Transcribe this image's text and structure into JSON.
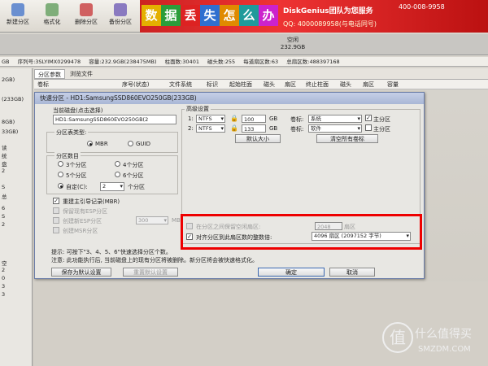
{
  "toolbar": {
    "items": [
      {
        "label": "新建分区"
      },
      {
        "label": "格式化"
      },
      {
        "label": "删除分区"
      },
      {
        "label": "备份分区"
      }
    ]
  },
  "banner": {
    "chars": [
      "数",
      "据",
      "丢",
      "失",
      "怎",
      "么",
      "办"
    ],
    "line1": "DiskGenius团队为您服务",
    "phone": "400-008-9958",
    "line2": "QQ: 4000089958(与电话同号)"
  },
  "disk": {
    "free_label": "空闲",
    "free_size": "232.9GB"
  },
  "diskinfo": {
    "items": [
      "GB",
      "序列号:3SLYIMX0299478",
      "容量:232.9GB(238475MB)",
      "柱面数:30401",
      "磁头数:255",
      "每道扇区数:63",
      "总扇区数:488397168"
    ]
  },
  "left": {
    "items": [
      "2GB)",
      "(233GB)",
      "8GB)",
      "33GB)",
      "读",
      "统",
      "盘",
      "2",
      "S",
      "总",
      "6",
      "S",
      "2",
      "空",
      "2",
      "0",
      "3",
      "3"
    ]
  },
  "tabs": {
    "items": [
      "分区参数",
      "浏览文件"
    ]
  },
  "columns": [
    "卷标",
    "序号(状态)",
    "文件系统",
    "标识",
    "起始柱面",
    "磁头",
    "扇区",
    "终止柱面",
    "磁头",
    "扇区",
    "容量"
  ],
  "dialog": {
    "title": "快速分区 - HD1:SamsungSSD860EVO250GB(233GB)",
    "current_disk_label": "当前磁盘(点击选择)",
    "current_disk_value": "HD1:SamsungSSD860EVO250GB(2",
    "table_type_label": "分区表类型:",
    "mbr": "MBR",
    "guid": "GUID",
    "count_label": "分区数目",
    "counts": [
      "3个分区",
      "4个分区",
      "5个分区",
      "6个分区"
    ],
    "custom_label": "自定(C):",
    "custom_value": "2",
    "custom_unit": "个分区",
    "rebuild_mbr": "重建主引导记录(MBR)",
    "keep_esp": "保留现有ESP分区",
    "create_esp": "创建新ESP分区",
    "create_esp_size": "300",
    "create_esp_unit": "MB",
    "create_msr": "创建MSR分区",
    "advanced_label": "高级设置",
    "rows": [
      {
        "num": "1:",
        "fs": "NTFS",
        "size": "100",
        "unit": "GB",
        "label_tag": "卷标:",
        "label": "系统",
        "primary": "主分区"
      },
      {
        "num": "2:",
        "fs": "NTFS",
        "size": "133",
        "unit": "GB",
        "label_tag": "卷标:",
        "label": "软件",
        "primary": "主分区"
      }
    ],
    "default_size_btn": "默认大小",
    "clear_labels_btn": "清空所有卷标",
    "reserve_label": "在分区之间保留空闲扇区:",
    "reserve_value": "2048",
    "reserve_unit": "扇区",
    "align_label": "对齐分区到此扇区数的整数倍:",
    "align_value": "4096 扇区 (2097152 字节)",
    "hint": "提示: 可按下\"3、4、5、6\"快速选择分区个数。",
    "note": "注意: 此功能执行后, 当前磁盘上的现有分区将被删除。新分区将会被快速格式化。",
    "save_default_btn": "保存为默认设置",
    "reset_default_btn": "重置默认设置",
    "ok_btn": "确定",
    "cancel_btn": "取消"
  },
  "watermark": {
    "logo": "值",
    "text": "什么值得买",
    "sub": "SMZDM.COM"
  }
}
